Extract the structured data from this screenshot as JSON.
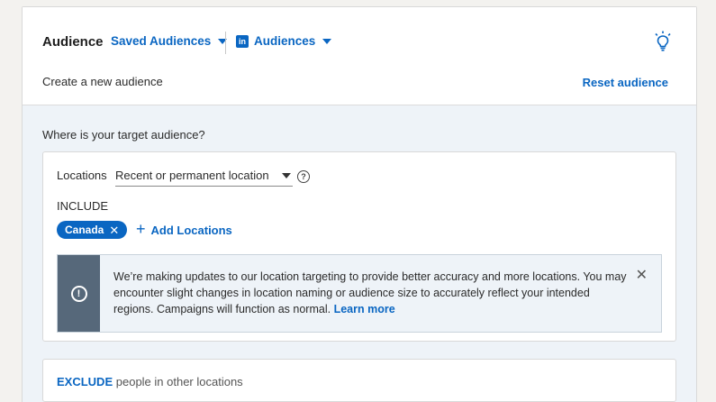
{
  "header": {
    "title": "Audience",
    "saved_audiences_label": "Saved Audiences",
    "audiences_label": "Audiences",
    "linkedin_icon_text": "in",
    "subtitle": "Create a new audience",
    "reset_label": "Reset audience"
  },
  "location_section": {
    "question": "Where is your target audience?",
    "locations_label": "Locations",
    "location_type_value": "Recent or permanent location",
    "include_label": "INCLUDE",
    "included_locations": [
      "Canada"
    ],
    "add_locations_label": "Add Locations"
  },
  "notice": {
    "text": "We’re making updates to our location targeting to provide better accuracy and more locations. You may encounter slight changes in location naming or audience size to accurately reflect your intended regions. Campaigns will function as normal.",
    "link_label": "Learn more"
  },
  "exclude": {
    "keyword": "EXCLUDE",
    "rest": "people in other locations"
  },
  "colors": {
    "accent": "#0a66c2",
    "notice_side": "#56687a",
    "body_bg": "#eef3f8"
  },
  "icons": {
    "caret": "chevron-down-icon",
    "bulb": "lightbulb-icon",
    "help": "help-icon",
    "close": "close-icon",
    "warning": "exclamation-icon",
    "plus": "plus-icon"
  }
}
